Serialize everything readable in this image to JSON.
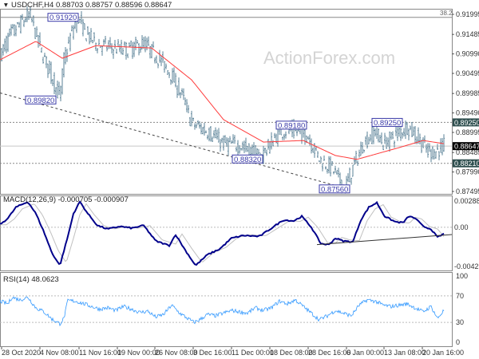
{
  "chart_data": {
    "type": "line",
    "title": "USDCHF,H4",
    "ohlc_header": "0.88703 0.88757 0.88596 0.88647",
    "watermark": "ActionForex.com",
    "fib_label": "38.2",
    "colors": {
      "bars": "#5a8197",
      "ma": "#ff3b3b",
      "macd": "#00008b",
      "signal": "#c0c0c0",
      "rsi": "#3399ff",
      "label": "#3a3aa8",
      "current_bg": "#000000",
      "level_bg": "#2f4f4f"
    },
    "price_axis": {
      "ylim": [
        0.87495,
        0.91995
      ],
      "ticks": [
        "0.91995",
        "0.91485",
        "0.90990",
        "0.90495",
        "0.89985",
        "0.89490",
        "0.88995",
        "0.88485",
        "0.87990",
        "0.87495"
      ]
    },
    "current_price": "0.88647",
    "levels": [
      {
        "price": 0.9192,
        "label": "0.91920",
        "style": "solid"
      },
      {
        "price": 0.8925,
        "label": "0.89250",
        "style": "dotted"
      },
      {
        "price": 0.8821,
        "label": "0.88210",
        "style": "dotted"
      }
    ],
    "annotations": [
      {
        "bar": 60,
        "price": 0.9192,
        "text": "0.91920"
      },
      {
        "bar": 32,
        "price": 0.8982,
        "text": "0.89820"
      },
      {
        "bar": 346,
        "price": 0.8918,
        "text": "0.89180"
      },
      {
        "bar": 291,
        "price": 0.8832,
        "text": "0.88320"
      },
      {
        "bar": 400,
        "price": 0.8756,
        "text": "0.87560"
      },
      {
        "bar": 466,
        "price": 0.8925,
        "text": "0.89250"
      }
    ],
    "price_path": [
      [
        0,
        0.9094
      ],
      [
        12,
        0.9145
      ],
      [
        25,
        0.9175
      ],
      [
        37,
        0.9199
      ],
      [
        44,
        0.9155
      ],
      [
        50,
        0.9114
      ],
      [
        60,
        0.9064
      ],
      [
        70,
        0.9013
      ],
      [
        75,
        0.8985
      ],
      [
        80,
        0.9084
      ],
      [
        90,
        0.9155
      ],
      [
        97,
        0.9195
      ],
      [
        105,
        0.9155
      ],
      [
        120,
        0.9125
      ],
      [
        140,
        0.9114
      ],
      [
        160,
        0.911
      ],
      [
        180,
        0.9125
      ],
      [
        200,
        0.9084
      ],
      [
        215,
        0.9043
      ],
      [
        225,
        0.9003
      ],
      [
        232,
        0.8972
      ],
      [
        240,
        0.8922
      ],
      [
        260,
        0.8902
      ],
      [
        280,
        0.8871
      ],
      [
        300,
        0.8867
      ],
      [
        320,
        0.8847
      ],
      [
        323,
        0.8832
      ],
      [
        335,
        0.8861
      ],
      [
        350,
        0.8902
      ],
      [
        365,
        0.8905
      ],
      [
        385,
        0.8892
      ],
      [
        400,
        0.8831
      ],
      [
        415,
        0.881
      ],
      [
        432,
        0.8758
      ],
      [
        440,
        0.88
      ],
      [
        455,
        0.8871
      ],
      [
        470,
        0.8905
      ],
      [
        480,
        0.8871
      ],
      [
        495,
        0.8892
      ],
      [
        510,
        0.8915
      ],
      [
        525,
        0.8882
      ],
      [
        535,
        0.8851
      ],
      [
        545,
        0.8851
      ],
      [
        556,
        0.8865
      ]
    ],
    "ma_path": [
      [
        0,
        0.9084
      ],
      [
        45,
        0.9131
      ],
      [
        78,
        0.9088
      ],
      [
        120,
        0.912
      ],
      [
        190,
        0.9114
      ],
      [
        240,
        0.9033
      ],
      [
        280,
        0.8932
      ],
      [
        330,
        0.8875
      ],
      [
        380,
        0.8879
      ],
      [
        420,
        0.8841
      ],
      [
        447,
        0.8831
      ],
      [
        500,
        0.8861
      ],
      [
        530,
        0.8879
      ],
      [
        556,
        0.8871
      ]
    ],
    "trendline": [
      [
        0,
        0.9
      ],
      [
        432,
        0.8758
      ]
    ],
    "macd": {
      "label": "MACD(12,26,9) -0.000705 -0.000907",
      "ylim": [
        -0.004298,
        0.00288
      ],
      "ticks": [
        "0.00288",
        "0.00",
        "-0.004298"
      ],
      "path": [
        [
          0,
          0.0003
        ],
        [
          10,
          0.001
        ],
        [
          20,
          0.0022
        ],
        [
          35,
          0.0028
        ],
        [
          45,
          0.0015
        ],
        [
          55,
          -0.0005
        ],
        [
          65,
          -0.0028
        ],
        [
          75,
          -0.0042
        ],
        [
          85,
          -0.001
        ],
        [
          92,
          0.0015
        ],
        [
          100,
          0.0028
        ],
        [
          110,
          0.0015
        ],
        [
          122,
          0.0002
        ],
        [
          135,
          -0.0002
        ],
        [
          150,
          0.0001
        ],
        [
          165,
          -0.0001
        ],
        [
          180,
          0.0002
        ],
        [
          195,
          -0.0015
        ],
        [
          212,
          -0.002
        ],
        [
          220,
          -0.0008
        ],
        [
          232,
          -0.0025
        ],
        [
          245,
          -0.0042
        ],
        [
          260,
          -0.003
        ],
        [
          275,
          -0.0024
        ],
        [
          290,
          -0.0012
        ],
        [
          305,
          -0.0009
        ],
        [
          325,
          -0.001
        ],
        [
          340,
          -0.0001
        ],
        [
          355,
          0.0008
        ],
        [
          368,
          0.0007
        ],
        [
          378,
          0.0012
        ],
        [
          390,
          0.0
        ],
        [
          402,
          -0.0018
        ],
        [
          412,
          -0.0019
        ],
        [
          420,
          -0.0012
        ],
        [
          430,
          -0.0015
        ],
        [
          442,
          -0.0016
        ],
        [
          452,
          0.0008
        ],
        [
          462,
          0.0022
        ],
        [
          472,
          0.0027
        ],
        [
          482,
          0.0012
        ],
        [
          495,
          0.0006
        ],
        [
          505,
          0.0005
        ],
        [
          512,
          0.0012
        ],
        [
          520,
          0.001
        ],
        [
          530,
          0.0001
        ],
        [
          540,
          -0.0002
        ],
        [
          548,
          -0.0011
        ],
        [
          556,
          -0.0007
        ]
      ],
      "support": [
        [
          397,
          -0.0019
        ],
        [
          566,
          -0.0008
        ]
      ]
    },
    "rsi": {
      "label": "RSI(14) 48.0623",
      "ylim": [
        0,
        100
      ],
      "ticks": [
        "100",
        "70",
        "30",
        "0"
      ],
      "path": [
        [
          0,
          62
        ],
        [
          10,
          58
        ],
        [
          15,
          68
        ],
        [
          25,
          64
        ],
        [
          35,
          68
        ],
        [
          40,
          60
        ],
        [
          45,
          52
        ],
        [
          55,
          46
        ],
        [
          65,
          35
        ],
        [
          75,
          28
        ],
        [
          80,
          36
        ],
        [
          85,
          63
        ],
        [
          95,
          62
        ],
        [
          105,
          58
        ],
        [
          115,
          54
        ],
        [
          125,
          50
        ],
        [
          135,
          52
        ],
        [
          145,
          48
        ],
        [
          155,
          54
        ],
        [
          165,
          50
        ],
        [
          175,
          45
        ],
        [
          185,
          47
        ],
        [
          195,
          38
        ],
        [
          205,
          42
        ],
        [
          215,
          56
        ],
        [
          225,
          44
        ],
        [
          235,
          36
        ],
        [
          243,
          30
        ],
        [
          250,
          34
        ],
        [
          260,
          42
        ],
        [
          270,
          40
        ],
        [
          280,
          44
        ],
        [
          290,
          48
        ],
        [
          300,
          46
        ],
        [
          310,
          44
        ],
        [
          320,
          52
        ],
        [
          330,
          48
        ],
        [
          340,
          52
        ],
        [
          350,
          62
        ],
        [
          360,
          58
        ],
        [
          370,
          64
        ],
        [
          380,
          54
        ],
        [
          390,
          44
        ],
        [
          400,
          34
        ],
        [
          410,
          40
        ],
        [
          420,
          48
        ],
        [
          430,
          44
        ],
        [
          440,
          40
        ],
        [
          450,
          56
        ],
        [
          460,
          64
        ],
        [
          470,
          62
        ],
        [
          480,
          56
        ],
        [
          490,
          54
        ],
        [
          500,
          56
        ],
        [
          510,
          58
        ],
        [
          520,
          52
        ],
        [
          530,
          46
        ],
        [
          540,
          54
        ],
        [
          548,
          36
        ],
        [
          556,
          48
        ]
      ]
    },
    "time_labels": [
      {
        "bar": 2,
        "text": "28 Oct 2020"
      },
      {
        "bar": 50,
        "text": "4 Nov 08:00"
      },
      {
        "bar": 99,
        "text": "11 Nov 16:00"
      },
      {
        "bar": 147,
        "text": "19 Nov 00:00"
      },
      {
        "bar": 194,
        "text": "26 Nov 08:00"
      },
      {
        "bar": 242,
        "text": "3 Dec 16:00"
      },
      {
        "bar": 290,
        "text": "11 Dec 00:00"
      },
      {
        "bar": 338,
        "text": "18 Dec 08:00"
      },
      {
        "bar": 386,
        "text": "28 Dec 16:00"
      },
      {
        "bar": 434,
        "text": "6 Jan 00:00"
      },
      {
        "bar": 481,
        "text": "13 Jan 08:00"
      },
      {
        "bar": 529,
        "text": "20 Jan 16:00"
      }
    ]
  }
}
